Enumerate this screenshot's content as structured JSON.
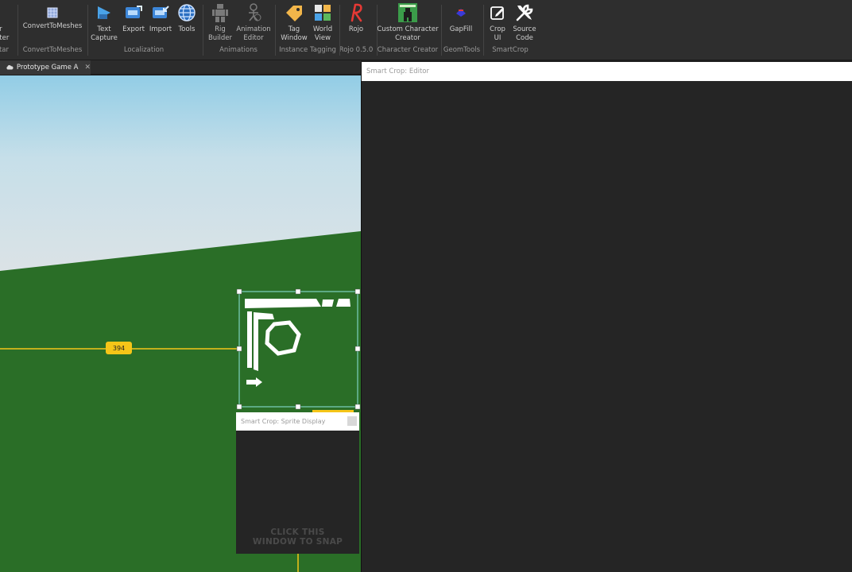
{
  "ribbon": {
    "tools": [
      {
        "name": "avatar-importer-tool",
        "label": "tar\norter",
        "icon": "avatar-importer-icon"
      },
      {
        "name": "converttomeshes-tool",
        "label": "ConvertToMeshes",
        "icon": "mesh-convert-icon"
      },
      {
        "name": "text-capture-tool",
        "label": "Text\nCapture",
        "icon": "text-capture-icon"
      },
      {
        "name": "export-tool",
        "label": "Export",
        "icon": "export-icon"
      },
      {
        "name": "import-tool",
        "label": "Import",
        "icon": "import-icon"
      },
      {
        "name": "tools-tool",
        "label": "Tools",
        "icon": "globe-icon"
      },
      {
        "name": "rig-builder-tool",
        "label": "Rig\nBuilder",
        "icon": "rig-figure-icon"
      },
      {
        "name": "animation-editor-tool",
        "label": "Animation\nEditor",
        "icon": "animation-figure-icon"
      },
      {
        "name": "tag-window-tool",
        "label": "Tag\nWindow",
        "icon": "tag-icon"
      },
      {
        "name": "world-view-tool",
        "label": "World\nView",
        "icon": "world-view-grid-icon"
      },
      {
        "name": "rojo-tool",
        "label": "Rojo",
        "icon": "rojo-logo-icon"
      },
      {
        "name": "custom-character-creator-tool",
        "label": "Custom Character\nCreator",
        "icon": "character-creator-icon"
      },
      {
        "name": "gapfill-tool",
        "label": "GapFill",
        "icon": "gapfill-icon"
      },
      {
        "name": "crop-ui-tool",
        "label": "Crop\nUI",
        "icon": "crop-edit-icon"
      },
      {
        "name": "source-code-tool",
        "label": "Source\nCode",
        "icon": "wrench-screwdriver-icon"
      }
    ],
    "groups": [
      "tar",
      "ConvertToMeshes",
      "Localization",
      "Animations",
      "Instance Tagging",
      "Rojo 0.5.0",
      "Character Creator",
      "GeomTools",
      "SmartCrop"
    ]
  },
  "tabs": [
    {
      "label": "Prototype Game A",
      "icon": "cloud-icon"
    }
  ],
  "viewport": {
    "dimension_label": "394"
  },
  "editor_panel": {
    "title": "Smart Crop: Editor"
  },
  "sprite_panel": {
    "title": "Smart Crop: Sprite Display",
    "snap_hint": "CLICK THIS\nWINDOW TO SNAP"
  },
  "colors": {
    "ribbon_bg": "#2e2e2e",
    "sky_top": "#92cde6",
    "ground": "#2a6e27",
    "selection": "#7fd0c0",
    "guide": "#f5c518",
    "panel_bg": "#252525"
  }
}
